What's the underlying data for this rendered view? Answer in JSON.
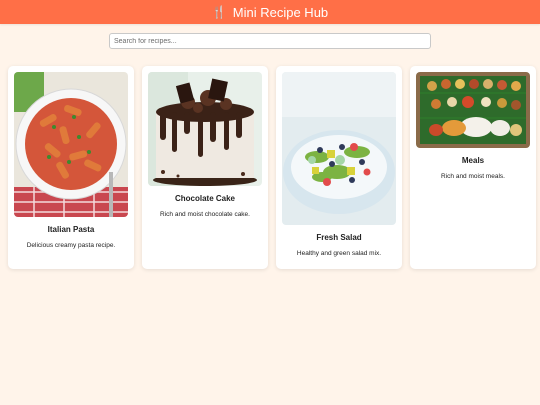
{
  "header": {
    "title": "Mini Recipe Hub",
    "icon": "fork-knife-icon"
  },
  "search": {
    "placeholder": "Search for recipes...",
    "value": ""
  },
  "recipes": [
    {
      "name": "Italian Pasta",
      "description": "Delicious creamy pasta recipe."
    },
    {
      "name": "Chocolate Cake",
      "description": "Rich and moist chocolate cake."
    },
    {
      "name": "Fresh Salad",
      "description": "Healthy and green salad mix."
    },
    {
      "name": "Meals",
      "description": "Rich and moist meals."
    }
  ],
  "colors": {
    "header": "#ff6f47",
    "background": "#fff4ea",
    "card": "#ffffff"
  }
}
